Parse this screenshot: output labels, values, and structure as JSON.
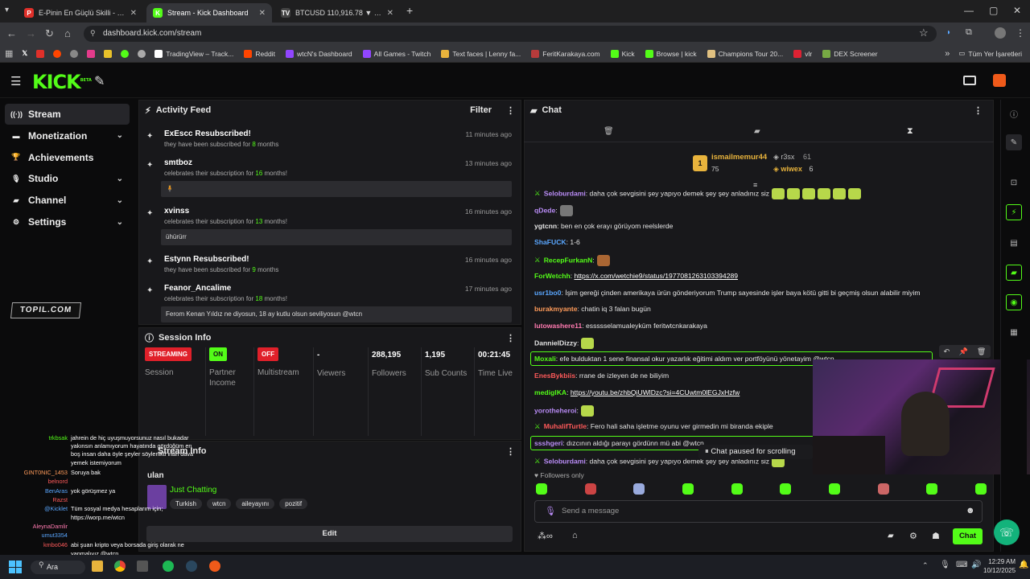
{
  "browser": {
    "tabs": [
      {
        "label": "E-Pinin En Güçlü Skilli - Pindirim",
        "icon_color": "#e0302a",
        "icon": "P",
        "active": false
      },
      {
        "label": "Stream - Kick Dashboard",
        "icon_color": "#53fc18",
        "icon": "K",
        "active": true
      },
      {
        "label": "BTCUSD 110,916.78 ▼ -1.83% ...",
        "icon_color": "#444",
        "icon": "TV",
        "active": false
      }
    ],
    "new_tab": "+",
    "url": "dashboard.kick.com/stream",
    "bookmarks": [
      "TradingView – Track...",
      "Reddit",
      "wtcN's Dashboard",
      "All Games - Twitch",
      "Text faces | Lenny fa...",
      "FeritKarakaya.com",
      "Kick",
      "Browse | kick",
      "Champions Tour 20...",
      "vlr",
      "DEX Screener"
    ],
    "bookmark_colors": [
      "#fff",
      "#ff4500",
      "#9146ff",
      "#9146ff",
      "#e8b33c",
      "#b73b3b",
      "#53fc18",
      "#53fc18",
      "#e0c080",
      "#d23",
      "#7a4"
    ],
    "bookmarks_folder": "Tüm Yer İşaretleri"
  },
  "kick": {
    "logo": "KICK",
    "logo_sup": "BETA",
    "accent": "#53fc18"
  },
  "sidebar": {
    "items": [
      {
        "label": "Stream",
        "icon": "broadcast-icon",
        "glyph": "((·))",
        "chevron": false,
        "selected": true
      },
      {
        "label": "Monetization",
        "icon": "money-icon",
        "glyph": "▬",
        "chevron": true,
        "selected": false
      },
      {
        "label": "Achievements",
        "icon": "trophy-icon",
        "glyph": "🏆",
        "chevron": false,
        "selected": false
      },
      {
        "label": "Studio",
        "icon": "mic-icon",
        "glyph": "🎙",
        "chevron": true,
        "selected": false
      },
      {
        "label": "Channel",
        "icon": "chat-icon",
        "glyph": "▰",
        "chevron": true,
        "selected": false
      },
      {
        "label": "Settings",
        "icon": "gear-icon",
        "glyph": "⚙",
        "chevron": true,
        "selected": false
      }
    ],
    "watermark": "TOPIL.COM"
  },
  "activity": {
    "title": "Activity Feed",
    "filter": "Filter",
    "items": [
      {
        "name": "ExEscc Resubscribed!",
        "pre": "they have been subscribed for ",
        "num": "8",
        "post": " months",
        "time": "11 minutes ago",
        "msg": ""
      },
      {
        "name": "smtboz",
        "pre": "celebrates their subscription for ",
        "num": "16",
        "post": " months!",
        "time": "13 minutes ago",
        "msg": "🧍"
      },
      {
        "name": "xvinss",
        "pre": "celebrates their subscription for ",
        "num": "13",
        "post": " months!",
        "time": "16 minutes ago",
        "msg": "ühürürr"
      },
      {
        "name": "Estynn Resubscribed!",
        "pre": "they have been subscribed for ",
        "num": "9",
        "post": " months",
        "time": "16 minutes ago",
        "msg": ""
      },
      {
        "name": "Feanor_Ancalime",
        "pre": "celebrates their subscription for ",
        "num": "18",
        "post": " months!",
        "time": "17 minutes ago",
        "msg": "Ferom Kenan Yıldız ne diyosun, 18 ay kutlu olsun seviliyosun @wtcn"
      }
    ]
  },
  "session": {
    "title": "Session Info",
    "cells": [
      {
        "value": "STREAMING",
        "value_type": "badge",
        "badge_bg": "#e0202a",
        "badge_fg": "#fff",
        "label": "Session"
      },
      {
        "value": "ON",
        "value_type": "badge",
        "badge_bg": "#53fc18",
        "badge_fg": "#111",
        "label": "Partner Income"
      },
      {
        "value": "OFF",
        "value_type": "badge",
        "badge_bg": "#e0202a",
        "badge_fg": "#fff",
        "label": "Multistream"
      },
      {
        "value": "-",
        "value_type": "text",
        "label": "Viewers"
      },
      {
        "value": "288,195",
        "value_type": "text",
        "label": "Followers"
      },
      {
        "value": "1,195",
        "value_type": "text",
        "label": "Sub Counts"
      },
      {
        "value": "00:21:45",
        "value_type": "text",
        "label": "Time Live"
      }
    ]
  },
  "stream_info": {
    "title": "Stream Info",
    "stream_title": "ulan",
    "category": "Just Chatting",
    "tags": [
      "Turkish",
      "wtcn",
      "aileyayını",
      "pozitif"
    ],
    "edit": "Edit"
  },
  "chat": {
    "title": "Chat",
    "leaderboard": [
      {
        "rank": "1",
        "name": "ismailmemur44",
        "score": "75"
      },
      {
        "name": "r3sx",
        "score": "61"
      },
      {
        "name": "wiwex",
        "score": "6"
      }
    ],
    "messages": [
      {
        "user": "Seloburdami",
        "color": "#b98cf6",
        "text": ": daha çok sevgisini şey yapıyo demek şey şey anladınız siz",
        "mod": true,
        "emotes": 6
      },
      {
        "user": "qDede",
        "color": "#b98cf6",
        "text": ":",
        "emotes": 1,
        "emote_color": "#777"
      },
      {
        "user": "ygtcnn",
        "color": "#e5e5e5",
        "text": ": ben en çok erayı görüyom reelslerde"
      },
      {
        "user": "ShaFUCK",
        "color": "#5aa7ff",
        "text": ": 1-6"
      },
      {
        "user": "RecepFurkanN",
        "color": "#53fc18",
        "text": ":",
        "mod": true,
        "emotes": 1,
        "emote_color": "#a63"
      },
      {
        "user": "ForWetchh",
        "color": "#53fc18",
        "text": ": ",
        "link": "https://x.com/wetchie9/status/1977081263103394289"
      },
      {
        "user": "usr1bo0",
        "color": "#5aa7ff",
        "text": ": İşim gereği çinden amerikaya ürün gönderiyorum Trump sayesinde işler baya kötü gitti bi geçmiş olsun alabilir miyim"
      },
      {
        "user": "burakmyante",
        "color": "#ff9b5a",
        "text": ": chatin iq 3 falan bugün"
      },
      {
        "user": "lutowashere11",
        "color": "#ff7ab0",
        "text": ": essssselamualeyküm feritwtcnkarakaya"
      },
      {
        "user": "DannielDizzy",
        "color": "#e5e5e5",
        "text": ":",
        "emotes": 1
      },
      {
        "user": "Moxali",
        "color": "#53fc18",
        "text": ": efe bulduktan 1 sene finansal okur yazarlık eğitimi aldım ver portföyünü yönetayim @wtcn",
        "highlight": true
      },
      {
        "user": "EnesBykbiis",
        "color": "#ff5a5a",
        "text": ": rrane de izleyen de ne biliyim"
      },
      {
        "user": "mediglKA",
        "color": "#53fc18",
        "text": ": ",
        "link": "https://youtu.be/zhbQiUWlDzc?si=4CUwtm0lEGJxHzfw"
      },
      {
        "user": "yorotheheroi",
        "color": "#b98cf6",
        "text": ":",
        "emotes": 1
      },
      {
        "user": "MuhalifTurtle",
        "color": "#ff5a5a",
        "text": ": Fero hali saha işletme oyunu ver girmedin mi biranda ekiple",
        "mod": true
      },
      {
        "user": "ssshgeri",
        "color": "#b98cf6",
        "text": ": dızcının aldığı parayı gördünn mü abi @wtcn",
        "highlight": true
      },
      {
        "user": "Seloburdami",
        "color": "#b98cf6",
        "text": ": daha çok sevgisini şey yapıyo demek şey şey anladınız siz",
        "mod": true,
        "emotes": 1
      }
    ],
    "paused": "Chat paused for scrolling",
    "followers_only": "Followers only",
    "input_placeholder": "Send a message",
    "send": "Chat"
  },
  "overlay_chat": [
    {
      "u": "trkbsak",
      "c": "#53fc18",
      "t": "jahrein de hiç uyuşmuyorsunuz nasıl bukadar"
    },
    {
      "u": "",
      "c": "#fff",
      "t": "yakınsın anlamıyorum hayatında gördüğüm en"
    },
    {
      "u": "",
      "c": "#fff",
      "t": "boş insan daha öyle şeyler söylenikti inan dava"
    },
    {
      "u": "",
      "c": "#fff",
      "t": "yemek istemiyorum"
    },
    {
      "u": "GINT0NIC_1453",
      "c": "#ff9b5a",
      "t": "Soruya bak"
    },
    {
      "u": "belnord",
      "c": "#ff5a5a",
      "t": ""
    },
    {
      "u": "BenAras",
      "c": "#5aa7ff",
      "t": "yok görüşmez ya"
    },
    {
      "u": "Razst",
      "c": "#ff5a5a",
      "t": ""
    },
    {
      "u": "@Kicklet",
      "c": "#5aa7ff",
      "t": "Tüm sosyal medya hesaplarım için;"
    },
    {
      "u": "",
      "c": "#fff",
      "t": "https://worp.me/wtcn"
    },
    {
      "u": "AleynaDamlir",
      "c": "#ff7ab0",
      "t": ""
    },
    {
      "u": "umut3354",
      "c": "#5aa7ff",
      "t": ""
    },
    {
      "u": "kmbo046",
      "c": "#ff5a5a",
      "t": "abi şuan kripto veya borsada giriş olarak ne"
    },
    {
      "u": "",
      "c": "#fff",
      "t": "yapmalıyız @wtcn"
    },
    {
      "u": "",
      "c": "#fff",
      "t": "soruları muhatap al mustafalar makarna"
    }
  ],
  "taskbar": {
    "search": "Ara",
    "time": "12:29 AM",
    "date": "10/12/2025"
  }
}
